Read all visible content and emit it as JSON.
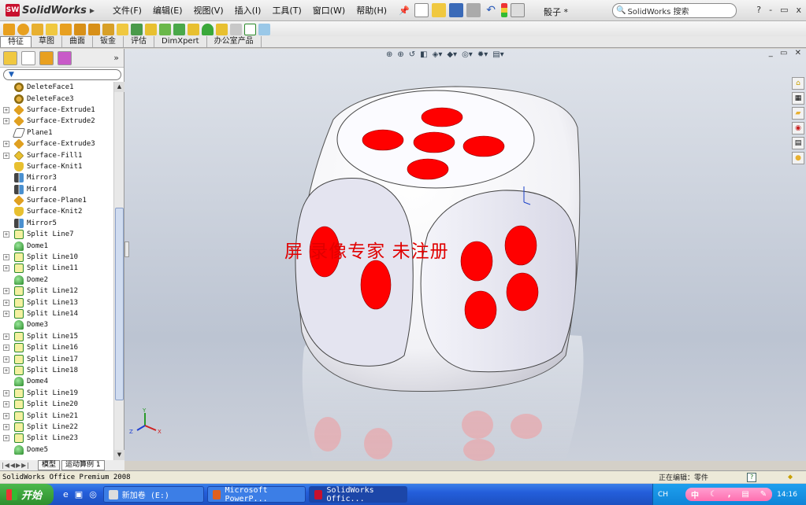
{
  "app": {
    "logo_mark": "SW",
    "logo_text": "SolidWorks",
    "menus": [
      "文件(F)",
      "编辑(E)",
      "视图(V)",
      "插入(I)",
      "工具(T)",
      "窗口(W)",
      "帮助(H)"
    ],
    "document_title": "骰子 *",
    "search_placeholder": "SolidWorks 搜索",
    "window_controls": [
      "?",
      "-",
      "▭",
      "x"
    ]
  },
  "command_tabs": [
    "特征",
    "草图",
    "曲面",
    "钣金",
    "评估",
    "DimXpert",
    "办公室产品"
  ],
  "feature_tree": {
    "items": [
      {
        "label": "DeleteFace1",
        "icon": "delete-face-icon",
        "expandable": false
      },
      {
        "label": "DeleteFace3",
        "icon": "delete-face-icon",
        "expandable": false
      },
      {
        "label": "Surface-Extrude1",
        "icon": "surface-extrude-icon",
        "expandable": true
      },
      {
        "label": "Surface-Extrude2",
        "icon": "surface-extrude-icon",
        "expandable": true
      },
      {
        "label": "Plane1",
        "icon": "plane-icon",
        "expandable": false
      },
      {
        "label": "Surface-Extrude3",
        "icon": "surface-extrude-icon",
        "expandable": true
      },
      {
        "label": "Surface-Fill1",
        "icon": "surface-fill-icon",
        "expandable": true
      },
      {
        "label": "Surface-Knit1",
        "icon": "surface-knit-icon",
        "expandable": false
      },
      {
        "label": "Mirror3",
        "icon": "mirror-icon",
        "expandable": false
      },
      {
        "label": "Mirror4",
        "icon": "mirror-icon",
        "expandable": false
      },
      {
        "label": "Surface-Plane1",
        "icon": "surface-plane-icon",
        "expandable": false
      },
      {
        "label": "Surface-Knit2",
        "icon": "surface-knit-icon",
        "expandable": false
      },
      {
        "label": "Mirror5",
        "icon": "mirror-icon",
        "expandable": false
      },
      {
        "label": "Split Line7",
        "icon": "split-line-icon",
        "expandable": true
      },
      {
        "label": "Dome1",
        "icon": "dome-icon",
        "expandable": false
      },
      {
        "label": "Split Line10",
        "icon": "split-line-icon",
        "expandable": true
      },
      {
        "label": "Split Line11",
        "icon": "split-line-icon",
        "expandable": true
      },
      {
        "label": "Dome2",
        "icon": "dome-icon",
        "expandable": false
      },
      {
        "label": "Split Line12",
        "icon": "split-line-icon",
        "expandable": true
      },
      {
        "label": "Split Line13",
        "icon": "split-line-icon",
        "expandable": true
      },
      {
        "label": "Split Line14",
        "icon": "split-line-icon",
        "expandable": true
      },
      {
        "label": "Dome3",
        "icon": "dome-icon",
        "expandable": false
      },
      {
        "label": "Split Line15",
        "icon": "split-line-icon",
        "expandable": true
      },
      {
        "label": "Split Line16",
        "icon": "split-line-icon",
        "expandable": true
      },
      {
        "label": "Split Line17",
        "icon": "split-line-icon",
        "expandable": true
      },
      {
        "label": "Split Line18",
        "icon": "split-line-icon",
        "expandable": true
      },
      {
        "label": "Dome4",
        "icon": "dome-icon",
        "expandable": false
      },
      {
        "label": "Split Line19",
        "icon": "split-line-icon",
        "expandable": true
      },
      {
        "label": "Split Line20",
        "icon": "split-line-icon",
        "expandable": true
      },
      {
        "label": "Split Line21",
        "icon": "split-line-icon",
        "expandable": true
      },
      {
        "label": "Split Line22",
        "icon": "split-line-icon",
        "expandable": true
      },
      {
        "label": "Split Line23",
        "icon": "split-line-icon",
        "expandable": true
      },
      {
        "label": "Dome5",
        "icon": "dome-icon",
        "expandable": false
      }
    ]
  },
  "bottom_tabs": [
    "模型",
    "运动算例 1"
  ],
  "viewport": {
    "watermark": "屏  录像专家  未注册",
    "triad": {
      "x": "X",
      "y": "Y",
      "z": "Z"
    }
  },
  "status": {
    "product": "SolidWorks Office Premium 2008",
    "mode": "正在编辑：零件",
    "help": "?"
  },
  "taskbar": {
    "start": "开始",
    "tasks": [
      "新加卷 (E:)",
      "Microsoft PowerP...",
      "SolidWorks Offic..."
    ],
    "lang": "CH",
    "ime": "中",
    "clock": "14:16"
  },
  "colors": {
    "pip": "#ff0000",
    "viewport_bg": "#c8ced8",
    "taskbar": "#245edb"
  }
}
